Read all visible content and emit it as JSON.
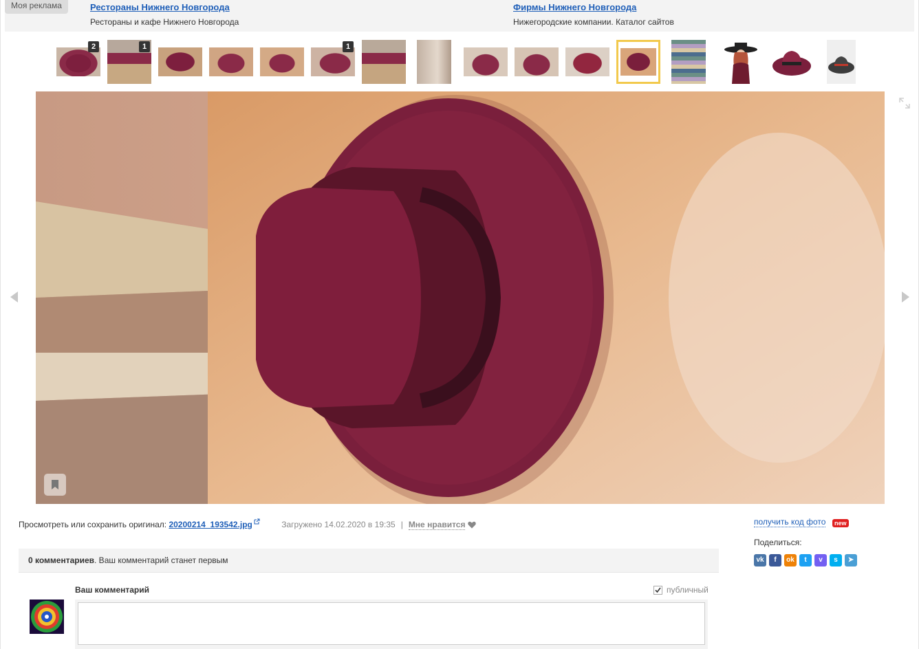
{
  "ads": {
    "label": "Моя реклама",
    "items": [
      {
        "title": "Рестораны Нижнего Новгорода",
        "desc": "Рестораны и кафе Нижнего Новгорода"
      },
      {
        "title": "Фирмы Нижнего Новгорода",
        "desc": "Нижегородские компании. Каталог сайтов"
      }
    ]
  },
  "thumbnails": [
    {
      "badge": "2"
    },
    {
      "badge": "1"
    },
    {
      "badge": ""
    },
    {
      "badge": ""
    },
    {
      "badge": ""
    },
    {
      "badge": "1"
    },
    {
      "badge": ""
    },
    {
      "badge": ""
    },
    {
      "badge": ""
    },
    {
      "badge": ""
    },
    {
      "badge": ""
    },
    {
      "badge": "",
      "active": true
    },
    {
      "badge": ""
    },
    {
      "badge": ""
    },
    {
      "badge": ""
    },
    {
      "badge": ""
    }
  ],
  "photo_info": {
    "prefix": "Просмотреть или сохранить оригинал:",
    "filename": "20200214_193542.jpg",
    "uploaded": "Загружено 14.02.2020 в 19:35",
    "separator": "|",
    "like": "Мне нравится"
  },
  "sidebar": {
    "get_code": "получить код фото",
    "new_badge": "new",
    "share_label": "Поделиться:",
    "share_icons": [
      {
        "name": "vk-icon",
        "text": "vk",
        "color": "#4a76a8"
      },
      {
        "name": "facebook-icon",
        "text": "f",
        "color": "#3b5998"
      },
      {
        "name": "odnoklassniki-icon",
        "text": "ok",
        "color": "#ee8208"
      },
      {
        "name": "twitter-icon",
        "text": "t",
        "color": "#1da1f2"
      },
      {
        "name": "viber-icon",
        "text": "v",
        "color": "#7360f2"
      },
      {
        "name": "skype-icon",
        "text": "s",
        "color": "#00aff0"
      },
      {
        "name": "telegram-icon",
        "text": "➤",
        "color": "#4a9fd5"
      }
    ]
  },
  "comments": {
    "count": "0 комментариев",
    "rest": ". Ваш комментарий станет первым",
    "your_comment": "Ваш комментарий",
    "public": "публичный"
  },
  "colors": {
    "link": "#1f5fb8",
    "active_thumb": "#f2c94c",
    "hat": "#7a1f3c"
  }
}
